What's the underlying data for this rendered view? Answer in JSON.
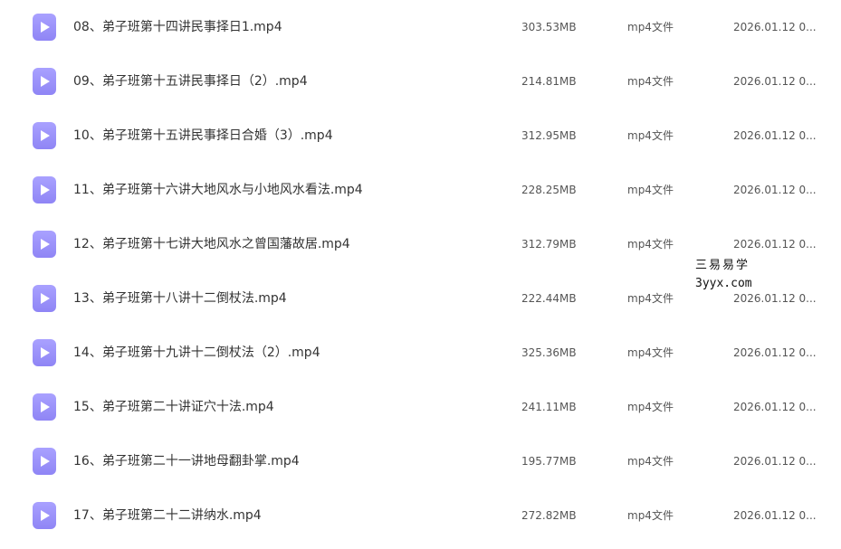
{
  "files": [
    {
      "name": "08、弟子班第十四讲民事择日1.mp4",
      "size": "303.53MB",
      "type": "mp4文件",
      "date": "2026.01.12 0..."
    },
    {
      "name": "09、弟子班第十五讲民事择日（2）.mp4",
      "size": "214.81MB",
      "type": "mp4文件",
      "date": "2026.01.12 0..."
    },
    {
      "name": "10、弟子班第十五讲民事择日合婚（3）.mp4",
      "size": "312.95MB",
      "type": "mp4文件",
      "date": "2026.01.12 0..."
    },
    {
      "name": "11、弟子班第十六讲大地风水与小地风水看法.mp4",
      "size": "228.25MB",
      "type": "mp4文件",
      "date": "2026.01.12 0..."
    },
    {
      "name": "12、弟子班第十七讲大地风水之曾国藩故居.mp4",
      "size": "312.79MB",
      "type": "mp4文件",
      "date": "2026.01.12 0..."
    },
    {
      "name": "13、弟子班第十八讲十二倒杖法.mp4",
      "size": "222.44MB",
      "type": "mp4文件",
      "date": "2026.01.12 0..."
    },
    {
      "name": "14、弟子班第十九讲十二倒杖法（2）.mp4",
      "size": "325.36MB",
      "type": "mp4文件",
      "date": "2026.01.12 0..."
    },
    {
      "name": "15、弟子班第二十讲证穴十法.mp4",
      "size": "241.11MB",
      "type": "mp4文件",
      "date": "2026.01.12 0..."
    },
    {
      "name": "16、弟子班第二十一讲地母翻卦掌.mp4",
      "size": "195.77MB",
      "type": "mp4文件",
      "date": "2026.01.12 0..."
    },
    {
      "name": "17、弟子班第二十二讲纳水.mp4",
      "size": "272.82MB",
      "type": "mp4文件",
      "date": "2026.01.12 0..."
    }
  ],
  "icon": {
    "name": "video-file-icon",
    "color": "#9d94fb"
  },
  "watermark": {
    "line1": "三易易学",
    "line2": "3yyx.com"
  }
}
